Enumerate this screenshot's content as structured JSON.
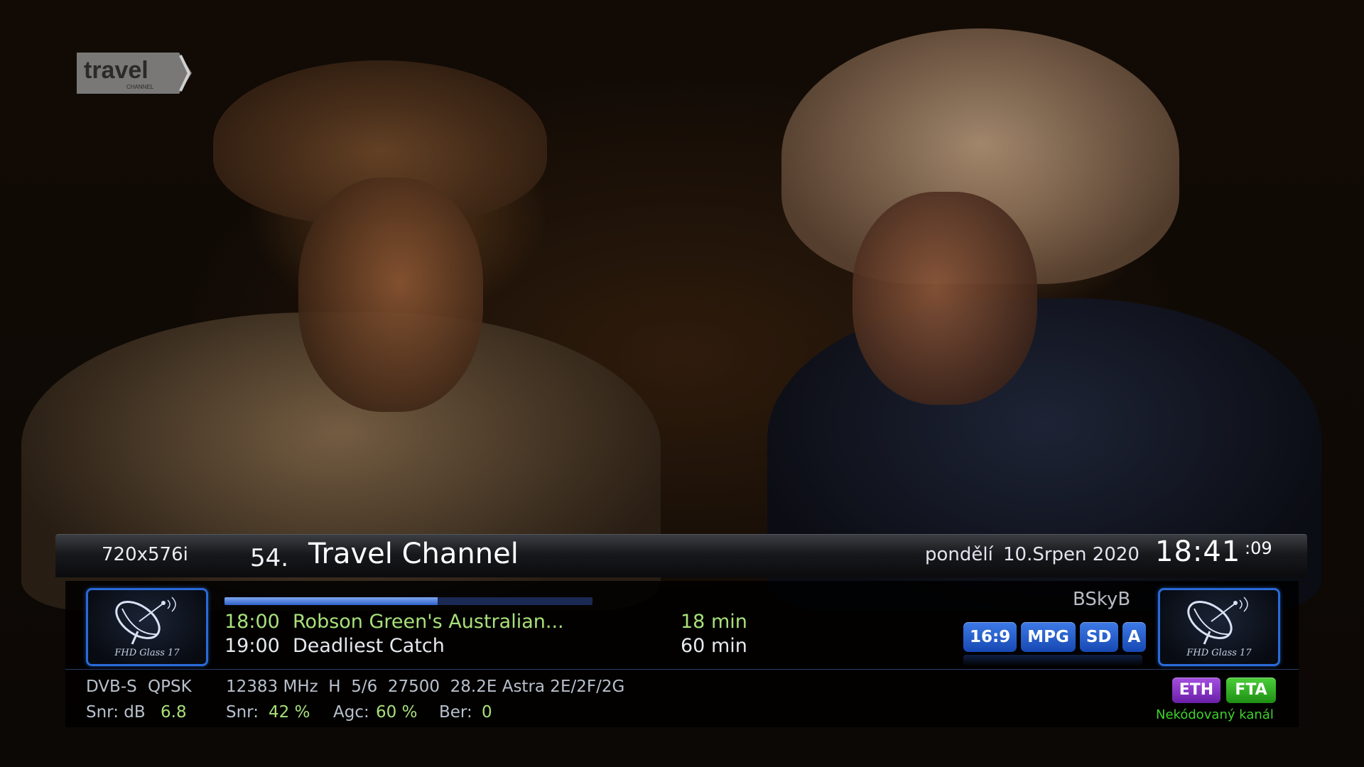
{
  "watermark": {
    "logo_text": "travel",
    "logo_subtext": "CHANNEL"
  },
  "infobar": {
    "resolution": "720x576i",
    "channel_number": "54.",
    "channel_name": "Travel Channel",
    "day": "pondělí",
    "date": "10.Srpen 2020",
    "clock": "18:41",
    "clock_seconds": ":09",
    "provider": "BSkyB",
    "picon_label": "FHD Glass 17",
    "event_progress": 0.58,
    "epg": {
      "now": {
        "time": "18:00",
        "title": "Robson Green's Australian...",
        "duration": "18 min"
      },
      "next": {
        "time": "19:00",
        "title": "Deadliest Catch",
        "duration": "60 min"
      }
    },
    "badges": [
      "16:9",
      "MPG",
      "SD",
      "A"
    ],
    "tuner": {
      "system": "DVB-S",
      "modulation": "QPSK",
      "transponder": "12383 MHz  H  5/6  27500  28.2E Astra 2E/2F/2G",
      "snr_db_label": "Snr: dB",
      "snr_db": "6.8",
      "snr_label": "Snr:",
      "snr": "42 %",
      "agc_label": "Agc:",
      "agc": "60 %",
      "ber_label": "Ber:",
      "ber": "0"
    },
    "flags": {
      "eth": "ETH",
      "fta": "FTA",
      "fta_text": "Nekódovaný kanál"
    },
    "colors": {
      "accent_blue": "#2f61c9",
      "epg_green": "#a8e07a",
      "eth_purple": "#6a1fa8",
      "fta_green": "#1e8f14"
    }
  }
}
